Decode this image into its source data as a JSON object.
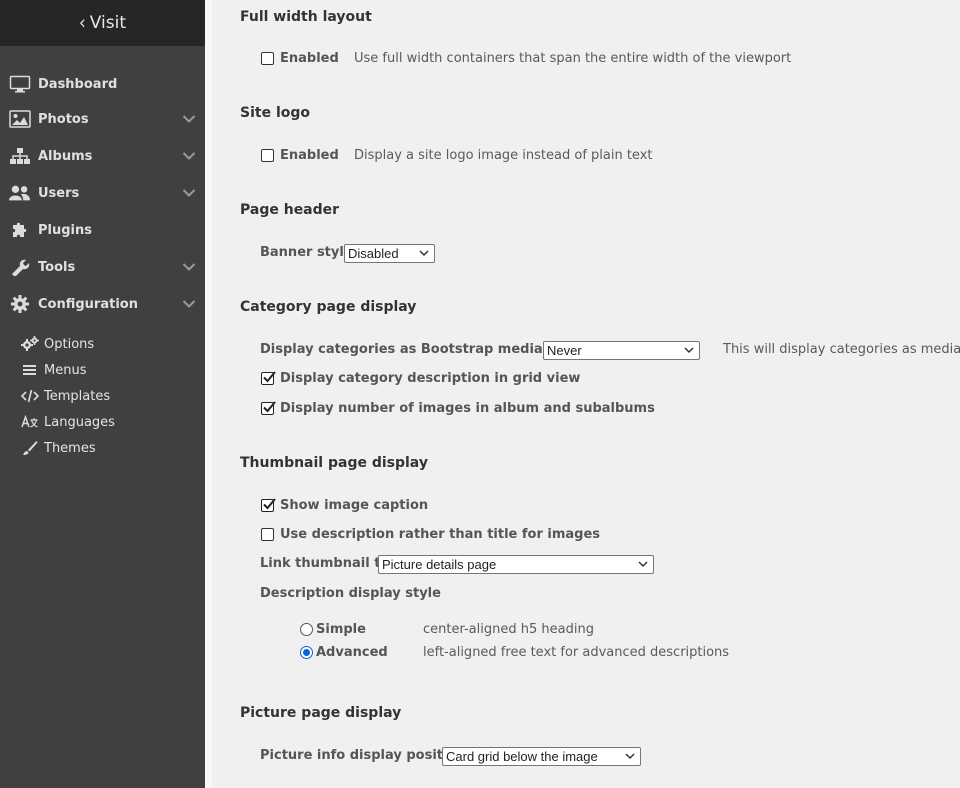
{
  "sidebar": {
    "visit": "Visit",
    "nav": [
      {
        "label": "Dashboard",
        "icon": "monitor-icon",
        "expandable": false
      },
      {
        "label": "Photos",
        "icon": "image-icon",
        "expandable": true
      },
      {
        "label": "Albums",
        "icon": "sitemap-icon",
        "expandable": true
      },
      {
        "label": "Users",
        "icon": "users-icon",
        "expandable": true
      },
      {
        "label": "Plugins",
        "icon": "puzzle-icon",
        "expandable": false
      },
      {
        "label": "Tools",
        "icon": "wrench-icon",
        "expandable": true
      },
      {
        "label": "Configuration",
        "icon": "gear-icon",
        "expandable": true
      }
    ],
    "config_items": [
      {
        "label": "Options",
        "icon": "cogs-icon"
      },
      {
        "label": "Menus",
        "icon": "bars-icon"
      },
      {
        "label": "Templates",
        "icon": "code-icon"
      },
      {
        "label": "Languages",
        "icon": "language-icon"
      },
      {
        "label": "Themes",
        "icon": "brush-icon"
      }
    ]
  },
  "sections": {
    "full_width": {
      "heading": "Full width layout",
      "checkbox_label": "Enabled",
      "checked": false,
      "description": "Use full width containers that span the entire width of the viewport"
    },
    "site_logo": {
      "heading": "Site logo",
      "checkbox_label": "Enabled",
      "checked": false,
      "description": "Display a site logo image instead of plain text"
    },
    "page_header": {
      "heading": "Page header",
      "banner_label": "Banner style",
      "banner_value": "Disabled"
    },
    "category": {
      "heading": "Category page display",
      "media_wells_label": "Display categories as Bootstrap media wells",
      "media_wells_value": "Never",
      "media_wells_description": "This will display categories as media wel",
      "desc_grid_label": "Display category description in grid view",
      "desc_grid_checked": true,
      "num_images_label": "Display number of images in album and subalbums",
      "num_images_checked": true
    },
    "thumbnail": {
      "heading": "Thumbnail page display",
      "show_caption_label": "Show image caption",
      "show_caption_checked": true,
      "use_desc_label": "Use description rather than title for images",
      "use_desc_checked": false,
      "link_label": "Link thumbnail to",
      "link_value": "Picture details page",
      "desc_style_label": "Description display style",
      "radios": [
        {
          "label": "Simple",
          "description": "center-aligned h5 heading",
          "selected": false
        },
        {
          "label": "Advanced",
          "description": "left-aligned free text for advanced descriptions",
          "selected": true
        }
      ]
    },
    "picture": {
      "heading": "Picture page display",
      "info_label": "Picture info display position",
      "info_value": "Card grid below the image"
    }
  }
}
